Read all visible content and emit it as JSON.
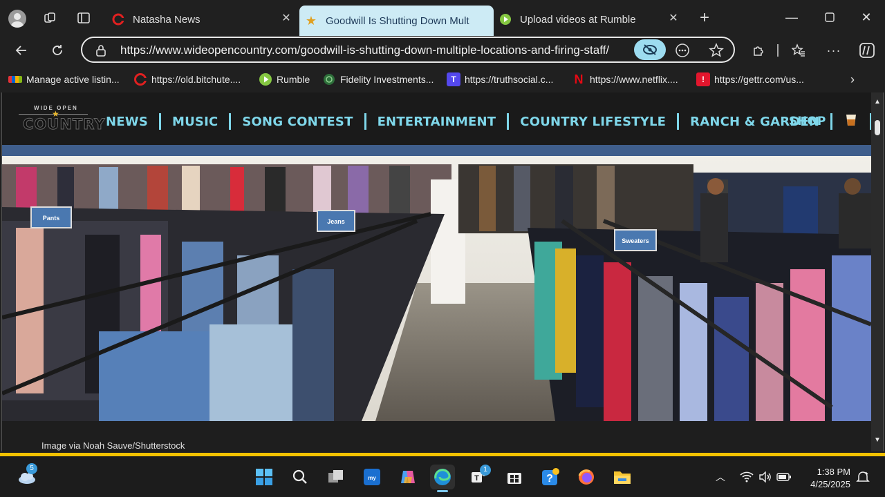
{
  "tabs": [
    {
      "title": "Natasha News",
      "icon": "red-c-icon",
      "active": false
    },
    {
      "title": "Goodwill Is Shutting Down Multip",
      "icon": "star-icon",
      "active": true
    },
    {
      "title": "Upload videos at Rumble",
      "icon": "rumble-icon",
      "active": false
    }
  ],
  "address_bar": {
    "url": "https://www.wideopencountry.com/goodwill-is-shutting-down-multiple-locations-and-firing-staff/"
  },
  "bookmarks": [
    {
      "label": "Manage active listin...",
      "icon": "ebay-icon"
    },
    {
      "label": "https://old.bitchute....",
      "icon": "bitchute-icon"
    },
    {
      "label": "Rumble",
      "icon": "rumble-icon"
    },
    {
      "label": "Fidelity Investments...",
      "icon": "fidelity-icon"
    },
    {
      "label": "https://truthsocial.c...",
      "icon": "truthsocial-icon"
    },
    {
      "label": "https://www.netflix....",
      "icon": "netflix-icon"
    },
    {
      "label": "https://gettr.com/us...",
      "icon": "gettr-icon"
    }
  ],
  "site": {
    "logo_top": "WIDE OPEN",
    "logo_bottom": "COUNTRY",
    "menu": [
      "NEWS",
      "MUSIC",
      "SONG CONTEST",
      "ENTERTAINMENT",
      "COUNTRY LIFESTYLE",
      "RANCH & GARDEN"
    ],
    "shop": "SHOP",
    "hero_signs": [
      "Pants",
      "Jeans",
      "Sweaters"
    ],
    "caption": "Image via Noah Sauve/Shutterstock"
  },
  "taskbar": {
    "weather_badge": "5",
    "teams_badge": "1",
    "time": "1:38 PM",
    "date": "4/25/2025"
  }
}
